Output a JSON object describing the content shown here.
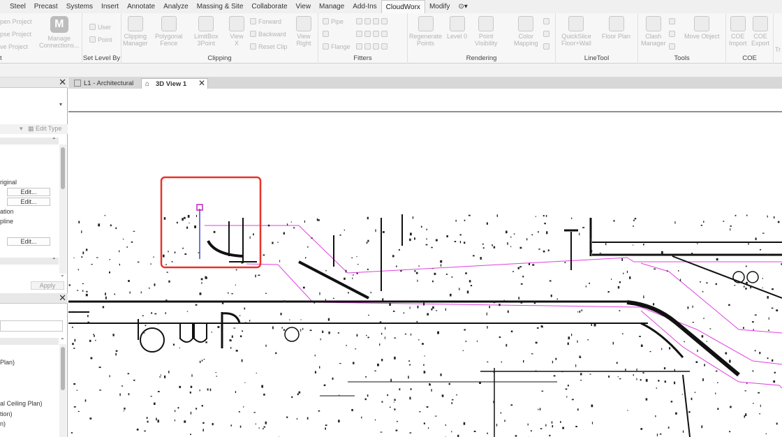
{
  "menu": {
    "tabs": [
      "Steel",
      "Precast",
      "Systems",
      "Insert",
      "Annotate",
      "Analyze",
      "Massing & Site",
      "Collaborate",
      "View",
      "Manage",
      "Add-Ins",
      "CloudWorx",
      "Modify"
    ],
    "active_tab": "CloudWorx",
    "extra_icon": "camera-dropdown-icon"
  },
  "ribbon": {
    "project_panel": {
      "items": [
        "pen Project",
        "pse Project",
        "ve Project"
      ],
      "label": "t"
    },
    "manage": {
      "label": "Manage\nConnections",
      "line1": "Manage",
      "line2": "Connections..."
    },
    "set_level": {
      "items": [
        "User",
        "Point"
      ],
      "label": "Set Level By"
    },
    "clipping": {
      "buttons": [
        {
          "line1": "Clipping",
          "line2": "Manager"
        },
        {
          "line1": "Polygonal",
          "line2": "Fence"
        },
        {
          "line1": "LimitBox",
          "line2": "3Point"
        },
        {
          "line1": "View",
          "line2": "X"
        },
        {
          "line1": "View",
          "line2": "Right"
        }
      ],
      "small": [
        "Forward",
        "Backward",
        "Reset Clip"
      ],
      "label": "Clipping"
    },
    "fitters": {
      "small": [
        "Pipe",
        "Flange"
      ],
      "label": "Fitters"
    },
    "rendering": {
      "buttons": [
        {
          "line1": "Regenerate",
          "line2": "Points"
        },
        {
          "line1": "Level 0",
          "line2": ""
        },
        {
          "line1": "Point",
          "line2": "Visibility"
        },
        {
          "line1": "Color",
          "line2": "Mapping"
        }
      ],
      "label": "Rendering"
    },
    "linetool": {
      "buttons": [
        {
          "line1": "QuickSlice",
          "line2": "Floor+Wall"
        },
        {
          "line1": "Floor Plan",
          "line2": ""
        }
      ],
      "label": "LineTool"
    },
    "tools": {
      "buttons": [
        {
          "line1": "Clash",
          "line2": "Manager"
        },
        {
          "line1": "Move Object",
          "line2": ""
        }
      ],
      "label": "Tools"
    },
    "coe": {
      "buttons": [
        {
          "line1": "COE",
          "line2": "Import"
        },
        {
          "line1": "COE",
          "line2": "Export"
        }
      ],
      "label": "COE",
      "truncated": "Tr"
    }
  },
  "properties_panel": {
    "edit_type": "Edit Type",
    "rows": [
      "riginal",
      "ation",
      "pline"
    ],
    "edit_label": "Edit...",
    "apply_label": "Apply"
  },
  "project_browser": {
    "items": [
      "Plan)",
      "al Ceiling Plan)",
      "tion)",
      "n)"
    ]
  },
  "view_tabs": [
    {
      "label": "L1 - Architectural",
      "icon": "floor-plan-icon",
      "active": false
    },
    {
      "label": "3D View 1",
      "icon": "home-icon",
      "active": true
    }
  ],
  "colors": {
    "highlight_box": "#e8332a",
    "pipe_outline": "#e040e0",
    "level_marker": "#c020c0",
    "vertical_line": "#4444cc",
    "active_tab_bg": "#ffffff"
  }
}
